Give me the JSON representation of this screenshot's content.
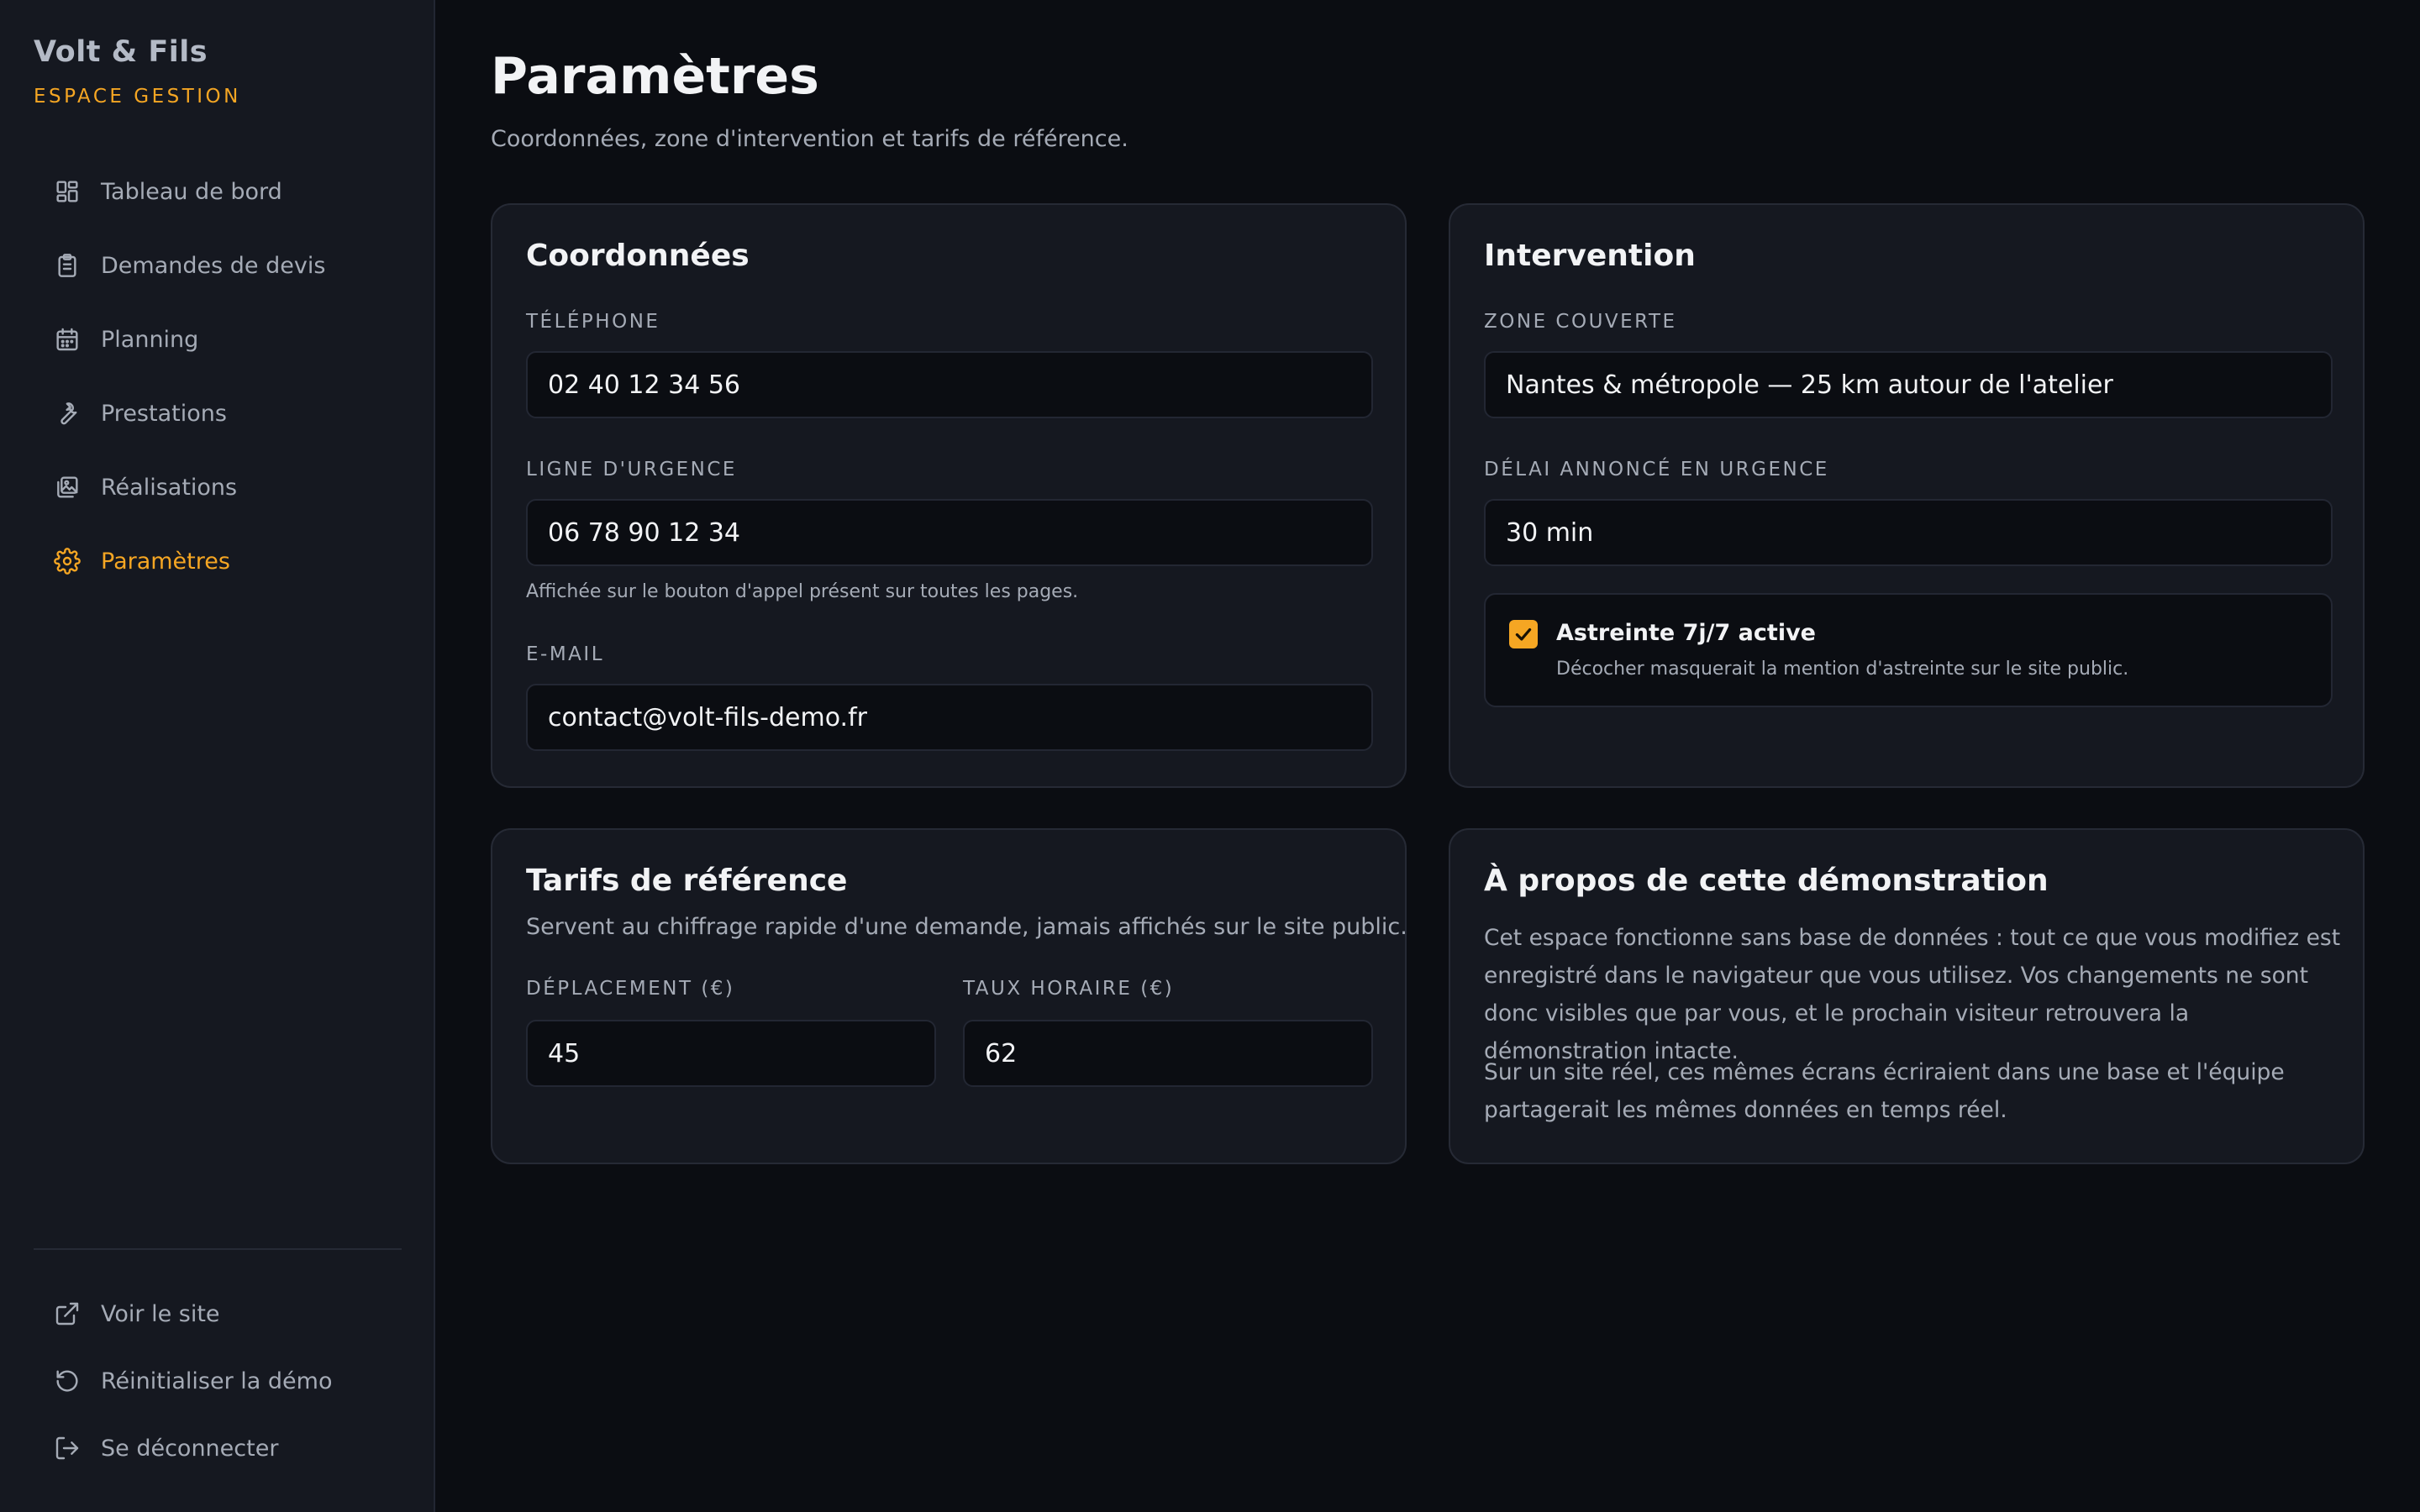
{
  "sidebar": {
    "brand": "Volt & Fils",
    "brand_sub": "ESPACE GESTION",
    "items": [
      {
        "label": "Tableau de bord",
        "icon": "dashboard-icon"
      },
      {
        "label": "Demandes de devis",
        "icon": "clipboard-icon"
      },
      {
        "label": "Planning",
        "icon": "calendar-icon"
      },
      {
        "label": "Prestations",
        "icon": "wrench-icon"
      },
      {
        "label": "Réalisations",
        "icon": "gallery-icon"
      },
      {
        "label": "Paramètres",
        "icon": "gear-icon",
        "active": true
      }
    ],
    "bottom_items": [
      {
        "label": "Voir le site",
        "icon": "external-link-icon"
      },
      {
        "label": "Réinitialiser la démo",
        "icon": "reset-icon"
      },
      {
        "label": "Se déconnecter",
        "icon": "logout-icon"
      }
    ]
  },
  "page": {
    "title": "Paramètres",
    "subtitle": "Coordonnées, zone d'intervention et tarifs de référence."
  },
  "coordonnees": {
    "title": "Coordonnées",
    "phone_label": "TÉLÉPHONE",
    "phone_value": "02 40 12 34 56",
    "urgence_label": "LIGNE D'URGENCE",
    "urgence_value": "06 78 90 12 34",
    "urgence_hint": "Affichée sur le bouton d'appel présent sur toutes les pages.",
    "email_label": "E-MAIL",
    "email_value": "contact@volt-fils-demo.fr"
  },
  "intervention": {
    "title": "Intervention",
    "zone_label": "ZONE COUVERTE",
    "zone_value": "Nantes & métropole — 25 km autour de l'atelier",
    "delai_label": "DÉLAI ANNONCÉ EN URGENCE",
    "delai_value": "30 min",
    "astreinte_label": "Astreinte 7j/7 active",
    "astreinte_desc": "Décocher masquerait la mention d'astreinte sur le site public.",
    "astreinte_checked": true
  },
  "tarifs": {
    "title": "Tarifs de référence",
    "desc": "Servent au chiffrage rapide d'une demande, jamais affichés sur le site public.",
    "deplacement_label": "DÉPLACEMENT (€)",
    "deplacement_value": "45",
    "taux_label": "TAUX HORAIRE (€)",
    "taux_value": "62"
  },
  "apropos": {
    "title": "À propos de cette démonstration",
    "para1": "Cet espace fonctionne sans base de données : tout ce que vous modifiez est enregistré dans le navigateur que vous utilisez. Vos changements ne sont donc visibles que par vous, et le prochain visiteur retrouvera la démonstration intacte.",
    "para2": "Sur un site réel, ces mêmes écrans écriraient dans une base et l'équipe partagerait les mêmes données en temps réel."
  },
  "colors": {
    "accent": "#f5a623",
    "background": "#0b0d12",
    "surface": "#151820",
    "text_muted": "#a5abb6"
  }
}
